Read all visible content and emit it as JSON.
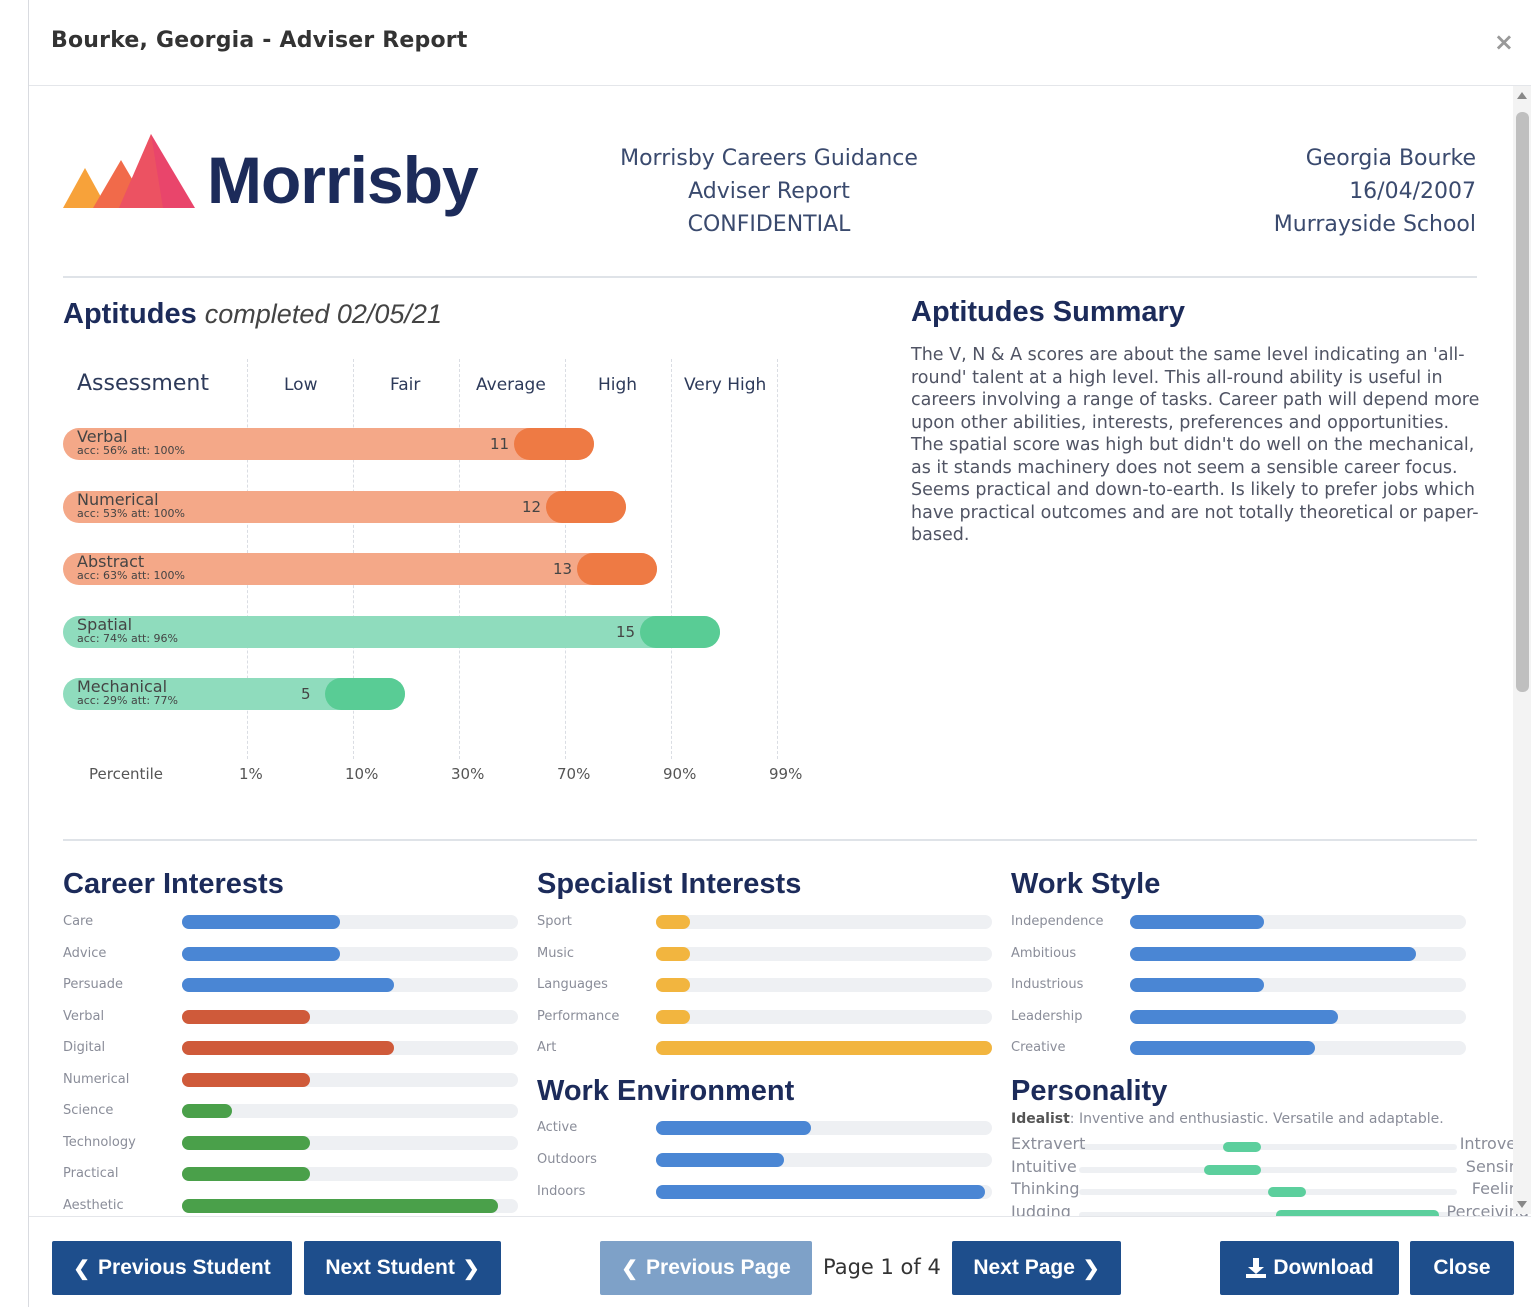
{
  "window": {
    "title": "Bourke, Georgia - Adviser Report",
    "close_glyph": "×"
  },
  "report": {
    "brand": "Morrisby",
    "center_lines": [
      "Morrisby Careers Guidance",
      "Adviser Report",
      "CONFIDENTIAL"
    ],
    "right_lines": [
      "Georgia Bourke",
      "16/04/2007",
      "Murrayside School"
    ]
  },
  "aptitudes": {
    "title": "Aptitudes",
    "completed": "completed 02/05/21",
    "assessment_label": "Assessment",
    "levels": [
      "Low",
      "Fair",
      "Average",
      "High",
      "Very High"
    ],
    "percentile_label": "Percentile",
    "percentiles": [
      "1%",
      "10%",
      "30%",
      "70%",
      "90%",
      "99%"
    ],
    "rows": [
      {
        "name": "Verbal",
        "acc": "acc: 56% att: 100%",
        "score": "11",
        "fraction": 0.59,
        "group": "orange"
      },
      {
        "name": "Numerical",
        "acc": "acc: 53% att: 100%",
        "score": "12",
        "fraction": 0.625,
        "group": "orange"
      },
      {
        "name": "Abstract",
        "acc": "acc: 63% att: 100%",
        "score": "13",
        "fraction": 0.66,
        "group": "orange"
      },
      {
        "name": "Spatial",
        "acc": "acc: 74% att: 96%",
        "score": "15",
        "fraction": 0.73,
        "group": "green"
      },
      {
        "name": "Mechanical",
        "acc": "acc: 29% att: 77%",
        "score": "5",
        "fraction": 0.38,
        "group": "green"
      }
    ]
  },
  "summary": {
    "title": "Aptitudes Summary",
    "text": "The V, N & A scores are about the same level indicating an 'all-round' talent at a high level. This all-round ability is useful in careers involving a range of tasks. Career path will depend more upon other abilities, interests, preferences and opportunities. The spatial score was high but didn't do well on the mechanical, as it stands machinery does not seem a sensible career focus. Seems practical and down-to-earth. Is likely to prefer jobs which have practical outcomes and are not totally theoretical or paper-based."
  },
  "career_interests": {
    "title": "Career Interests",
    "items": [
      {
        "label": "Care",
        "value": 0.47,
        "color": "#4a86d4"
      },
      {
        "label": "Advice",
        "value": 0.47,
        "color": "#4a86d4"
      },
      {
        "label": "Persuade",
        "value": 0.63,
        "color": "#4a86d4"
      },
      {
        "label": "Verbal",
        "value": 0.38,
        "color": "#cf5a3a"
      },
      {
        "label": "Digital",
        "value": 0.63,
        "color": "#cf5a3a"
      },
      {
        "label": "Numerical",
        "value": 0.38,
        "color": "#cf5a3a"
      },
      {
        "label": "Science",
        "value": 0.15,
        "color": "#4aa04a"
      },
      {
        "label": "Technology",
        "value": 0.38,
        "color": "#4aa04a"
      },
      {
        "label": "Practical",
        "value": 0.38,
        "color": "#4aa04a"
      },
      {
        "label": "Aesthetic",
        "value": 0.94,
        "color": "#4aa04a"
      }
    ]
  },
  "specialist_interests": {
    "title": "Specialist Interests",
    "items": [
      {
        "label": "Sport",
        "value": 0.1,
        "color": "#f2b53f"
      },
      {
        "label": "Music",
        "value": 0.1,
        "color": "#f2b53f"
      },
      {
        "label": "Languages",
        "value": 0.1,
        "color": "#f2b53f"
      },
      {
        "label": "Performance",
        "value": 0.1,
        "color": "#f2b53f"
      },
      {
        "label": "Art",
        "value": 1.0,
        "color": "#f2b53f"
      }
    ]
  },
  "work_environment": {
    "title": "Work Environment",
    "items": [
      {
        "label": "Active",
        "value": 0.46,
        "color": "#4a86d4"
      },
      {
        "label": "Outdoors",
        "value": 0.38,
        "color": "#4a86d4"
      },
      {
        "label": "Indoors",
        "value": 0.98,
        "color": "#4a86d4"
      }
    ]
  },
  "work_style": {
    "title": "Work Style",
    "items": [
      {
        "label": "Independence",
        "value": 0.4,
        "color": "#4a86d4"
      },
      {
        "label": "Ambitious",
        "value": 0.85,
        "color": "#4a86d4"
      },
      {
        "label": "Industrious",
        "value": 0.4,
        "color": "#4a86d4"
      },
      {
        "label": "Leadership",
        "value": 0.62,
        "color": "#4a86d4"
      },
      {
        "label": "Creative",
        "value": 0.55,
        "color": "#4a86d4"
      }
    ]
  },
  "personality": {
    "title": "Personality",
    "type": "Idealist",
    "desc": ": Inventive and enthusiastic. Versatile and adaptable.",
    "pairs": [
      {
        "left": "Extravert",
        "right": "Introvert",
        "from": 0.38,
        "to": 0.48
      },
      {
        "left": "Intuitive",
        "right": "Sensing",
        "from": 0.33,
        "to": 0.48
      },
      {
        "left": "Thinking",
        "right": "Feeling",
        "from": 0.5,
        "to": 0.6
      },
      {
        "left": "Judging",
        "right": "Perceiving",
        "from": 0.52,
        "to": 0.95
      }
    ]
  },
  "footer": {
    "prev_student": "Previous Student",
    "next_student": "Next Student",
    "prev_page": "Previous Page",
    "page_indicator": "Page 1 of 4",
    "next_page": "Next Page",
    "download": "Download",
    "close": "Close"
  },
  "colors": {
    "brand_navy": "#1c2b5a",
    "button_blue": "#1e4e8c",
    "orange_bar": "#f4a888",
    "orange_cap": "#ee7a44",
    "green_bar": "#8fdcbd",
    "green_cap": "#59cc95"
  }
}
